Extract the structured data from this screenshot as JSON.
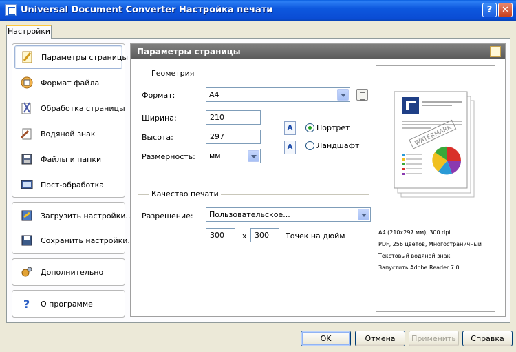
{
  "window": {
    "title": "Universal Document Converter Настройка печати",
    "help_label": "?",
    "close_label": "✕"
  },
  "tab": {
    "label": "Настройки"
  },
  "nav": {
    "items": [
      {
        "label": "Параметры страницы",
        "icon": "page-settings-icon"
      },
      {
        "label": "Формат файла",
        "icon": "file-format-icon"
      },
      {
        "label": "Обработка страницы",
        "icon": "page-processing-icon"
      },
      {
        "label": "Водяной знак",
        "icon": "watermark-icon"
      },
      {
        "label": "Файлы и папки",
        "icon": "files-folders-icon"
      },
      {
        "label": "Пост-обработка",
        "icon": "post-processing-icon"
      }
    ],
    "load_label": "Загрузить настройки...",
    "save_label": "Сохранить настройки...",
    "advanced_label": "Дополнительно",
    "about_label": "О программе"
  },
  "main": {
    "header": "Параметры страницы",
    "geometry": {
      "title": "Геометрия",
      "format_label": "Формат:",
      "format_value": "A4",
      "width_label": "Ширина:",
      "width_value": "210",
      "height_label": "Высота:",
      "height_value": "297",
      "units_label": "Размерность:",
      "units_value": "мм",
      "portrait_label": "Портрет",
      "landscape_label": "Ландшафт"
    },
    "quality": {
      "title": "Качество печати",
      "resolution_label": "Разрешение:",
      "resolution_value": "Пользовательское...",
      "dpi_x": "300",
      "times": "x",
      "dpi_y": "300",
      "dpi_unit": "Точек на дюйм"
    },
    "preview": {
      "watermark_text": "WATERMARK",
      "info": [
        "A4 (210x297 мм), 300 dpi",
        "PDF, 256 цветов, Многостраничный",
        "Текстовый водяной знак",
        "Запустить Adobe Reader 7.0"
      ]
    }
  },
  "buttons": {
    "ok": "OK",
    "cancel": "Отмена",
    "apply": "Применить",
    "help": "Справка"
  }
}
